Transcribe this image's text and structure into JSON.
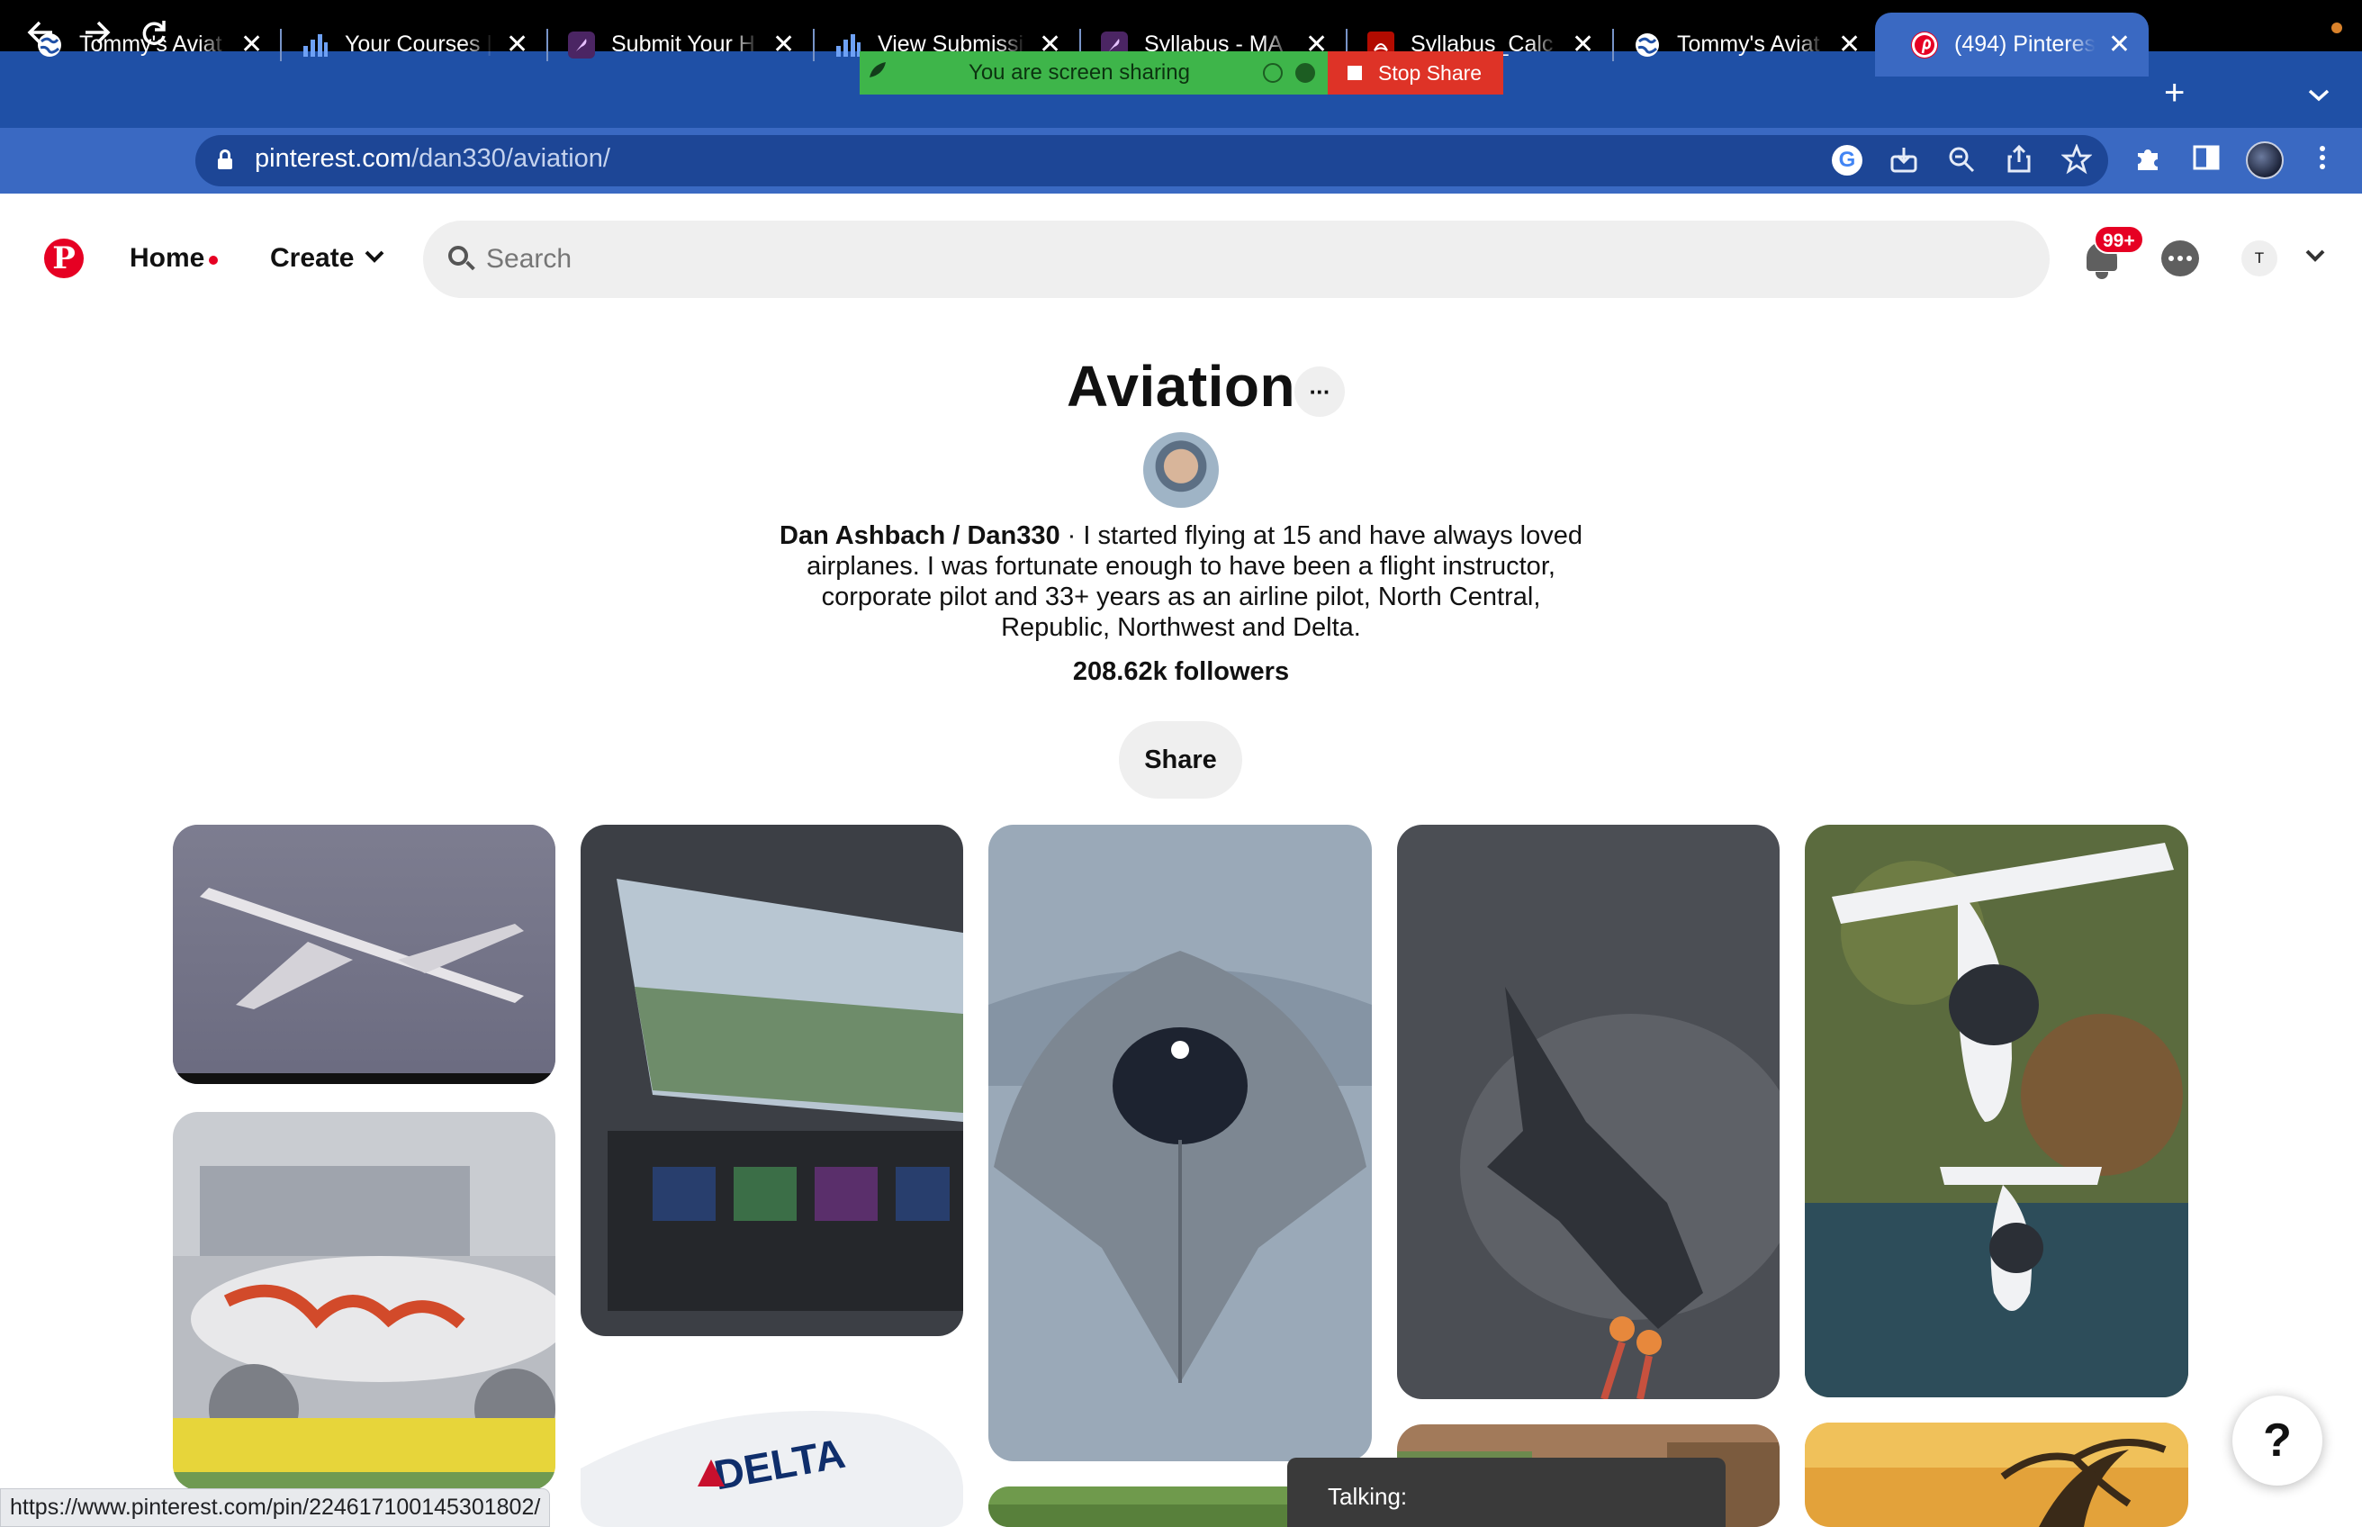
{
  "browser": {
    "tabs": [
      {
        "title": "Tommy's Aviat",
        "active": false,
        "favicon": "globe-icon"
      },
      {
        "title": "Your Courses |",
        "active": false,
        "favicon": "bar-chart-icon"
      },
      {
        "title": "Submit Your H",
        "active": false,
        "favicon": "feather-icon"
      },
      {
        "title": "View Submissi",
        "active": false,
        "favicon": "bar-chart-icon"
      },
      {
        "title": "Syllabus - MA",
        "active": false,
        "favicon": "feather-icon"
      },
      {
        "title": "Syllabus_Calc",
        "active": false,
        "favicon": "pdf-icon"
      },
      {
        "title": "Tommy's Aviat",
        "active": false,
        "favicon": "globe-icon"
      },
      {
        "title": "(494) Pinteres",
        "active": true,
        "favicon": "pinterest-icon"
      }
    ],
    "close_glyph": "✕",
    "new_tab_glyph": "+",
    "url_host": "pinterest.com",
    "url_path": "/dan330/aviation/",
    "screen_share": {
      "message": "You are screen sharing",
      "stop_label": "Stop Share"
    },
    "status_bar_url": "https://www.pinterest.com/pin/224617100145301802/"
  },
  "pinterest": {
    "logo": "P",
    "nav": {
      "home_label": "Home",
      "create_label": "Create"
    },
    "search": {
      "placeholder": "Search",
      "value": ""
    },
    "notifications_badge": "99+",
    "account_initial": "T"
  },
  "board": {
    "title": "Aviation",
    "more_glyph": "···",
    "owner": "Dan Ashbach / Dan330",
    "separator": " · ",
    "description": "I started flying at 15 and have always loved airplanes. I was fortunate enough to have been a flight instructor, corporate pilot and 33+ years as an airline pilot, North Central, Republic, Northwest and Delta.",
    "followers": "208.62k followers",
    "share_label": "Share"
  },
  "pins": [
    {
      "subject": "airliner-takeoff"
    },
    {
      "subject": "cockpit-view"
    },
    {
      "subject": "stealth-fighter-front"
    },
    {
      "subject": "jet-fighter-climb"
    },
    {
      "subject": "amphibious-light-aircraft"
    },
    {
      "subject": "painted-widebody-on-runway"
    },
    {
      "subject": "delta-747"
    },
    {
      "subject": "grass-partial"
    },
    {
      "subject": "partial-pin"
    },
    {
      "subject": "sunset-palms"
    }
  ],
  "overlays": {
    "talking_label": "Talking:",
    "help_glyph": "?"
  },
  "colors": {
    "pinterest_red": "#e60023",
    "chrome_blue": "#3a69c2",
    "share_green": "#3eb54a",
    "stop_red": "#de3327"
  }
}
